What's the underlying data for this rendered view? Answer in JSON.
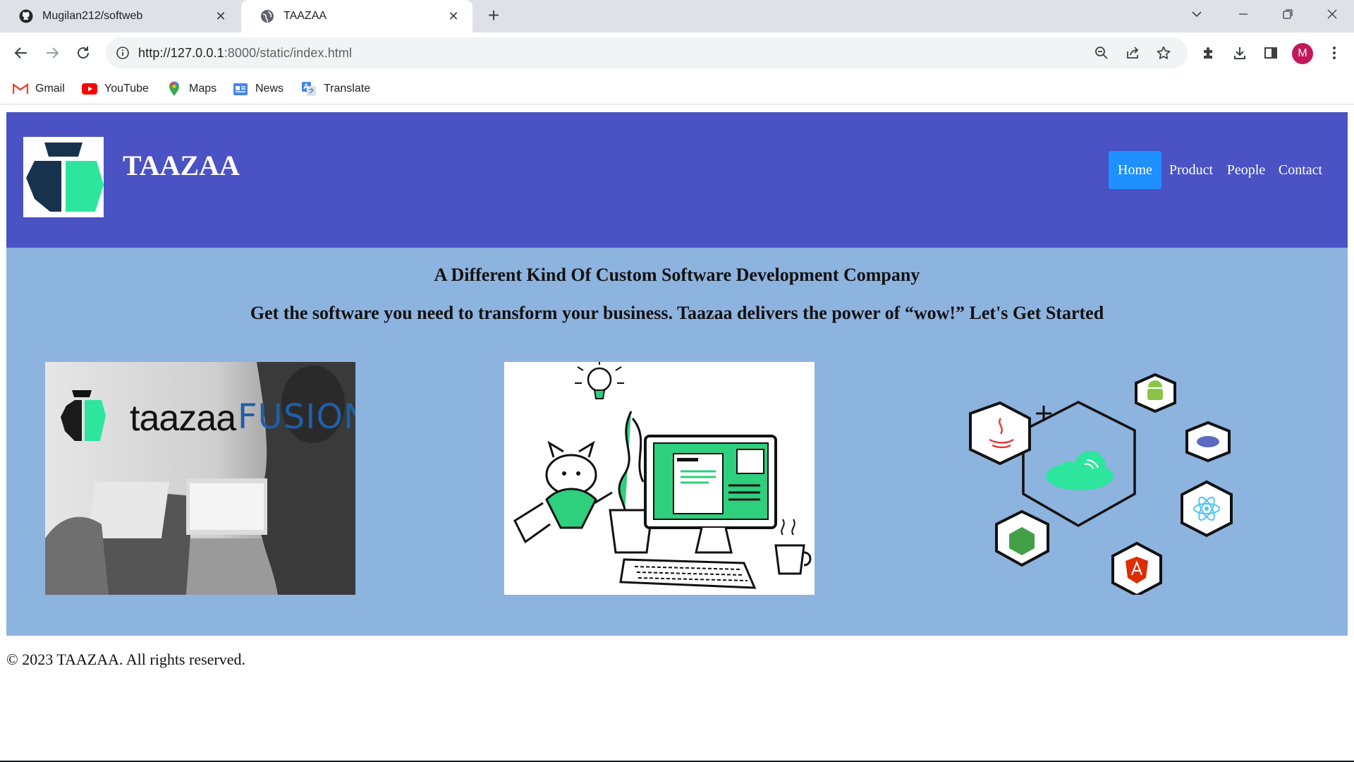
{
  "browser": {
    "tabs": [
      {
        "title": "Mugilan212/softweb",
        "icon": "github-icon",
        "active": false
      },
      {
        "title": "TAAZAA",
        "icon": "globe-icon",
        "active": true
      }
    ],
    "url_host": "http://127.0.0.1",
    "url_rest": ":8000/static/index.html",
    "avatar_letter": "M",
    "bookmarks": [
      "Gmail",
      "YouTube",
      "Maps",
      "News",
      "Translate"
    ]
  },
  "site": {
    "title": "TAAZAA",
    "nav": [
      "Home",
      "Product",
      "People",
      "Contact"
    ],
    "active_nav": "Home",
    "headline": "A Different Kind Of Custom Software Development Company",
    "subheadline": "Get the software you need to transform your business. Taazaa delivers the power of “wow!” Let's Get Started",
    "card1_brand": "taazaa",
    "card1_product": "FUSION",
    "footer": "© 2023 TAAZAA. All rights reserved."
  },
  "colors": {
    "header_bg": "#4a52c4",
    "hero_bg": "#8db3df",
    "nav_active": "#1e90ff",
    "logo_dark": "#17324d",
    "logo_green": "#2ee59d"
  }
}
